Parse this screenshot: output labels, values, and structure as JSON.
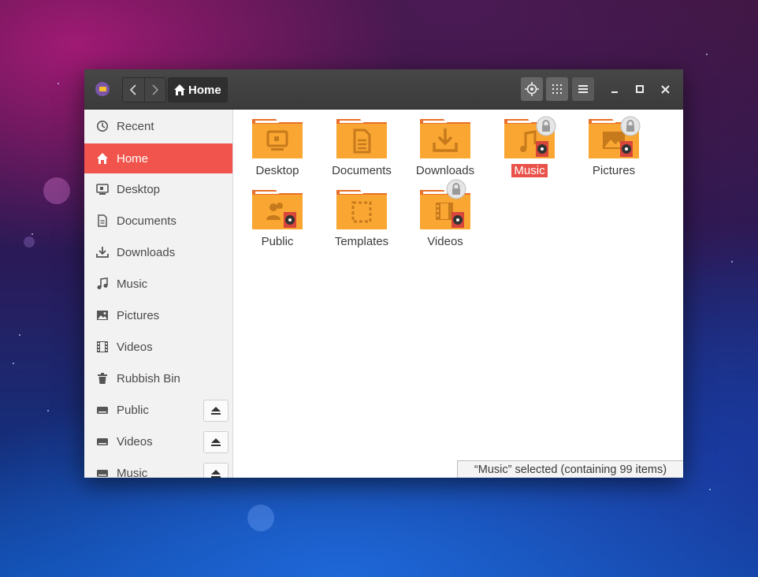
{
  "window": {
    "location_label": "Home"
  },
  "sidebar": {
    "items": [
      {
        "label": "Recent",
        "icon": "clock-icon"
      },
      {
        "label": "Home",
        "icon": "home-icon",
        "active": true
      },
      {
        "label": "Desktop",
        "icon": "desktop-icon"
      },
      {
        "label": "Documents",
        "icon": "document-icon"
      },
      {
        "label": "Downloads",
        "icon": "download-icon"
      },
      {
        "label": "Music",
        "icon": "music-icon"
      },
      {
        "label": "Pictures",
        "icon": "picture-icon"
      },
      {
        "label": "Videos",
        "icon": "film-icon"
      },
      {
        "label": "Rubbish Bin",
        "icon": "trash-icon"
      },
      {
        "label": "Public",
        "icon": "drive-icon",
        "eject": true
      },
      {
        "label": "Videos",
        "icon": "drive-icon",
        "eject": true
      },
      {
        "label": "Music",
        "icon": "drive-icon",
        "eject": true
      }
    ]
  },
  "files": [
    {
      "label": "Desktop",
      "emblem": "desktop",
      "lock": false,
      "shared": false
    },
    {
      "label": "Documents",
      "emblem": "document",
      "lock": false,
      "shared": false
    },
    {
      "label": "Downloads",
      "emblem": "download",
      "lock": false,
      "shared": false
    },
    {
      "label": "Music",
      "emblem": "music",
      "lock": true,
      "shared": true,
      "selected": true
    },
    {
      "label": "Pictures",
      "emblem": "picture",
      "lock": true,
      "shared": true
    },
    {
      "label": "Public",
      "emblem": "people",
      "lock": false,
      "shared": true
    },
    {
      "label": "Templates",
      "emblem": "template",
      "lock": false,
      "shared": false
    },
    {
      "label": "Videos",
      "emblem": "film",
      "lock": true,
      "shared": true
    }
  ],
  "status_bar": {
    "text": "“Music” selected  (containing 99 items)"
  },
  "colors": {
    "accent": "#f0544c",
    "folder": "#f9a632",
    "folder_tab": "#e8702a",
    "header": "#3f3f3f"
  }
}
